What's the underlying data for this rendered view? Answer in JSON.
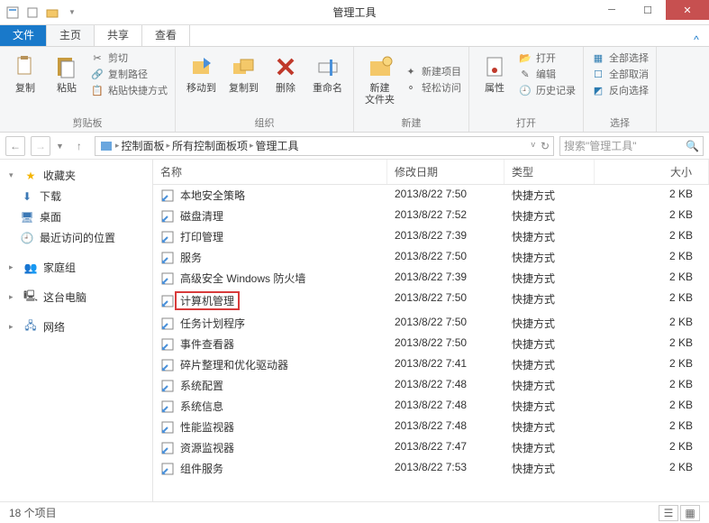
{
  "window": {
    "title": "管理工具"
  },
  "tabs": {
    "file": "文件",
    "home": "主页",
    "share": "共享",
    "view": "查看"
  },
  "ribbon": {
    "clipboard": {
      "label": "剪贴板",
      "copy": "复制",
      "paste": "粘贴",
      "cut": "剪切",
      "copy_path": "复制路径",
      "paste_shortcut": "粘贴快捷方式"
    },
    "organize": {
      "label": "组织",
      "move_to": "移动到",
      "copy_to": "复制到",
      "delete": "删除",
      "rename": "重命名"
    },
    "new": {
      "label": "新建",
      "new_folder": "新建\n文件夹",
      "new_item": "新建项目",
      "easy_access": "轻松访问"
    },
    "open": {
      "label": "打开",
      "properties": "属性",
      "open": "打开",
      "edit": "编辑",
      "history": "历史记录"
    },
    "select": {
      "label": "选择",
      "select_all": "全部选择",
      "select_none": "全部取消",
      "invert": "反向选择"
    }
  },
  "breadcrumb": [
    "控制面板",
    "所有控制面板项",
    "管理工具"
  ],
  "search_placeholder": "搜索\"管理工具\"",
  "nav": {
    "favorites": "收藏夹",
    "downloads": "下载",
    "desktop": "桌面",
    "recent": "最近访问的位置",
    "homegroup": "家庭组",
    "thispc": "这台电脑",
    "network": "网络"
  },
  "columns": {
    "name": "名称",
    "date": "修改日期",
    "type": "类型",
    "size": "大小"
  },
  "files": [
    {
      "name": "本地安全策略",
      "date": "2013/8/22 7:50",
      "type": "快捷方式",
      "size": "2 KB"
    },
    {
      "name": "磁盘清理",
      "date": "2013/8/22 7:52",
      "type": "快捷方式",
      "size": "2 KB"
    },
    {
      "name": "打印管理",
      "date": "2013/8/22 7:39",
      "type": "快捷方式",
      "size": "2 KB"
    },
    {
      "name": "服务",
      "date": "2013/8/22 7:50",
      "type": "快捷方式",
      "size": "2 KB"
    },
    {
      "name": "高级安全 Windows 防火墙",
      "date": "2013/8/22 7:39",
      "type": "快捷方式",
      "size": "2 KB"
    },
    {
      "name": "计算机管理",
      "date": "2013/8/22 7:50",
      "type": "快捷方式",
      "size": "2 KB",
      "highlight": true
    },
    {
      "name": "任务计划程序",
      "date": "2013/8/22 7:50",
      "type": "快捷方式",
      "size": "2 KB"
    },
    {
      "name": "事件查看器",
      "date": "2013/8/22 7:50",
      "type": "快捷方式",
      "size": "2 KB"
    },
    {
      "name": "碎片整理和优化驱动器",
      "date": "2013/8/22 7:41",
      "type": "快捷方式",
      "size": "2 KB"
    },
    {
      "name": "系统配置",
      "date": "2013/8/22 7:48",
      "type": "快捷方式",
      "size": "2 KB"
    },
    {
      "name": "系统信息",
      "date": "2013/8/22 7:48",
      "type": "快捷方式",
      "size": "2 KB"
    },
    {
      "name": "性能监视器",
      "date": "2013/8/22 7:48",
      "type": "快捷方式",
      "size": "2 KB"
    },
    {
      "name": "资源监视器",
      "date": "2013/8/22 7:47",
      "type": "快捷方式",
      "size": "2 KB"
    },
    {
      "name": "组件服务",
      "date": "2013/8/22 7:53",
      "type": "快捷方式",
      "size": "2 KB"
    }
  ],
  "status": {
    "count": "18 个项目"
  }
}
